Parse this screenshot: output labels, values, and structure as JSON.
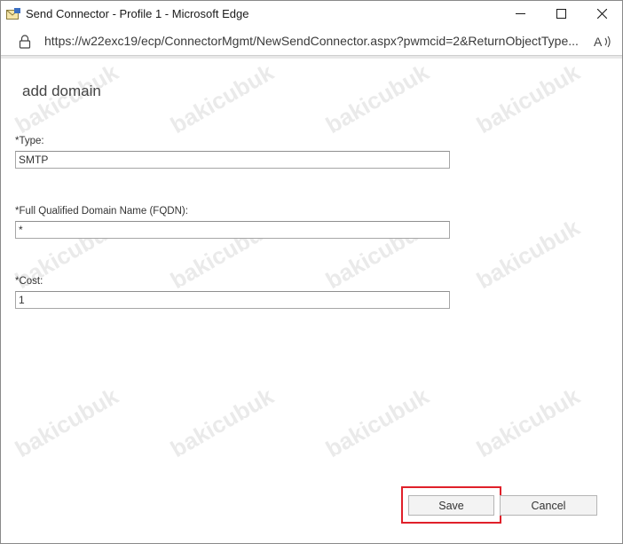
{
  "window": {
    "title": "Send Connector - Profile 1 - Microsoft Edge",
    "app_icon": "exchange-envelope-icon",
    "controls": {
      "minimize_icon": "minimize-icon",
      "maximize_icon": "maximize-icon",
      "close_icon": "close-icon"
    }
  },
  "address_bar": {
    "url": "https://w22exc19/ecp/ConnectorMgmt/NewSendConnector.aspx?pwmcid=2&ReturnObjectType...",
    "lock_icon": "lock-icon",
    "read_aloud_icon": "read-aloud-icon"
  },
  "page": {
    "heading": "add domain",
    "fields": [
      {
        "label": "*Type:",
        "value": "SMTP"
      },
      {
        "label": "*Full Qualified Domain Name (FQDN):",
        "value": "*"
      },
      {
        "label": "*Cost:",
        "value": "1"
      }
    ],
    "buttons": {
      "save": "Save",
      "cancel": "Cancel"
    }
  },
  "watermark": "bakicubuk",
  "colors": {
    "highlight": "#e0202a",
    "button_bg": "#f3f3f3",
    "button_border": "#b5b5b5"
  }
}
